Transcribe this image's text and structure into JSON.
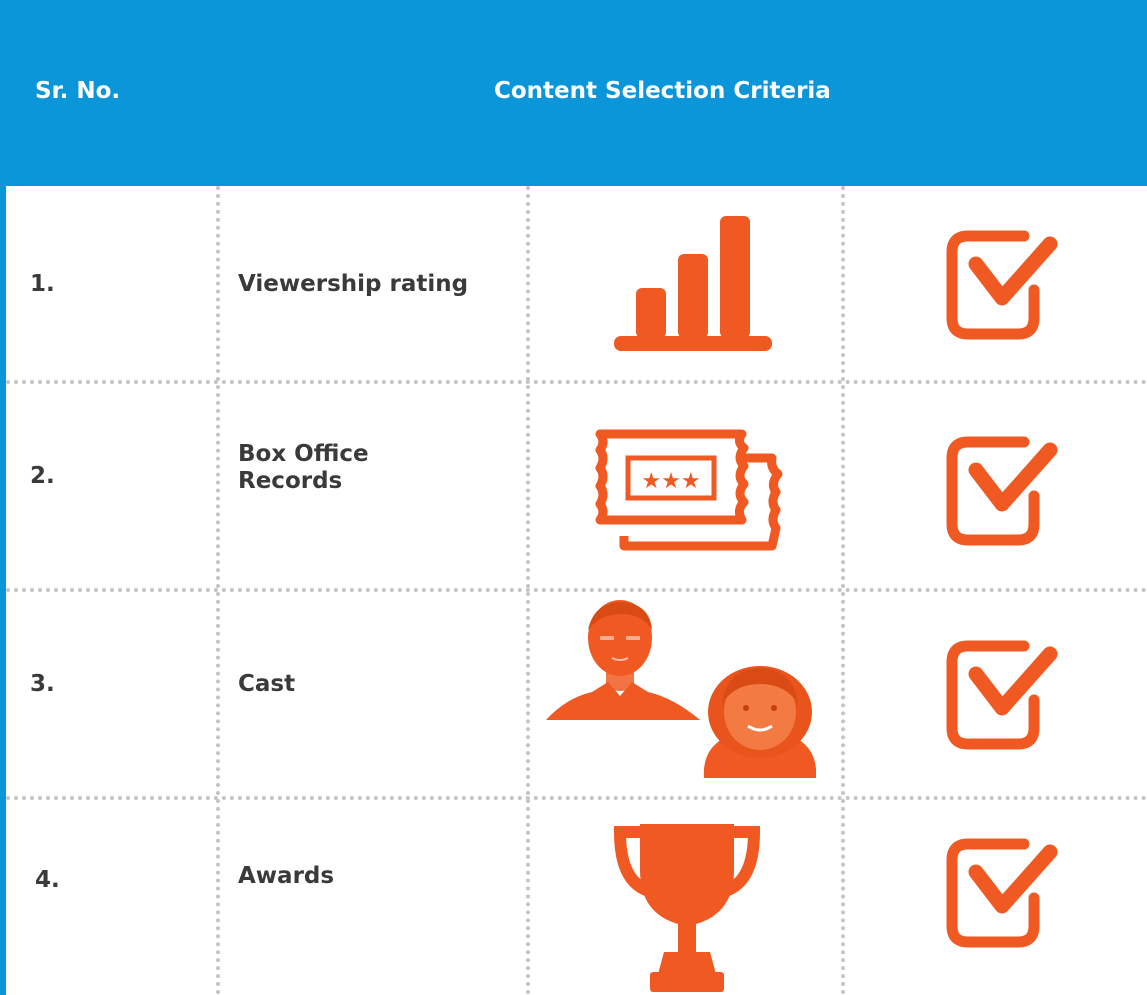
{
  "header": {
    "col_sr": "Sr. No.",
    "col_criteria": "Content Selection Criteria"
  },
  "colors": {
    "header_bg": "#0b96d9",
    "accent": "#f05a22",
    "text": "#3a3a3a",
    "divider": "#c4c4c4"
  },
  "rows": [
    {
      "num": "1.",
      "label": "Viewership rating",
      "icon": "bar-chart-icon",
      "status_icon": "checkbox-checked-icon"
    },
    {
      "num": "2.",
      "label": "Box Office Records",
      "icon": "ticket-icon",
      "status_icon": "checkbox-checked-icon"
    },
    {
      "num": "3.",
      "label": "Cast",
      "icon": "cast-portraits-icon",
      "status_icon": "checkbox-checked-icon"
    },
    {
      "num": "4.",
      "label": "Awards",
      "icon": "trophy-icon",
      "status_icon": "checkbox-checked-icon"
    }
  ]
}
